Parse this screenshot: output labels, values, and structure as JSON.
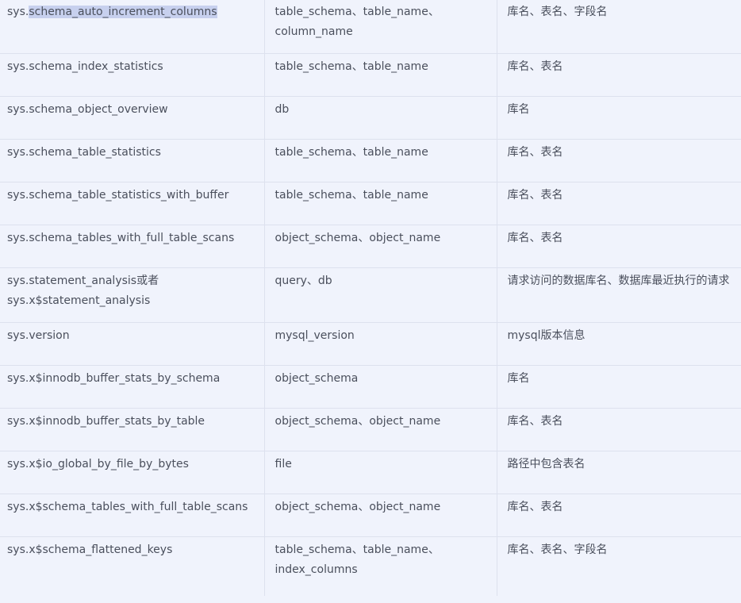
{
  "rows": [
    {
      "view_prefix": "sys.",
      "view_selected": "schema_auto_increment_columns",
      "view": "",
      "view_line2": "",
      "columns": "table_schema、table_name、",
      "columns_line2": "column_name",
      "desc": "库名、表名、字段名"
    },
    {
      "view": "sys.schema_index_statistics",
      "columns": "table_schema、table_name",
      "desc": "库名、表名"
    },
    {
      "view": "sys.schema_object_overview",
      "columns": "db",
      "desc": "库名"
    },
    {
      "view": "sys.schema_table_statistics",
      "columns": "table_schema、table_name",
      "desc": "库名、表名"
    },
    {
      "view": "sys.schema_table_statistics_with_buffer",
      "columns": "table_schema、table_name",
      "desc": "库名、表名"
    },
    {
      "view": "sys.schema_tables_with_full_table_scans",
      "columns": "object_schema、object_name",
      "desc": "库名、表名"
    },
    {
      "view": "sys.statement_analysis或者",
      "view_line2": "sys.x$statement_analysis",
      "columns": "query、db",
      "desc": "请求访问的数据库名、数据库最近执行的请求"
    },
    {
      "view": "sys.version",
      "columns": "mysql_version",
      "desc": "mysql版本信息"
    },
    {
      "view": "sys.x$innodb_buffer_stats_by_schema",
      "columns": "object_schema",
      "desc": "库名"
    },
    {
      "view": "sys.x$innodb_buffer_stats_by_table",
      "columns": "object_schema、object_name",
      "desc": "库名、表名"
    },
    {
      "view": "sys.x$io_global_by_file_by_bytes",
      "columns": "file",
      "desc": "路径中包含表名"
    },
    {
      "view": "sys.x$schema_tables_with_full_table_scans",
      "columns": "object_schema、object_name",
      "desc": "库名、表名"
    },
    {
      "view": "sys.x$schema_flattened_keys",
      "columns": "table_schema、table_name、",
      "columns_line2": "index_columns",
      "desc": "库名、表名、字段名"
    }
  ]
}
